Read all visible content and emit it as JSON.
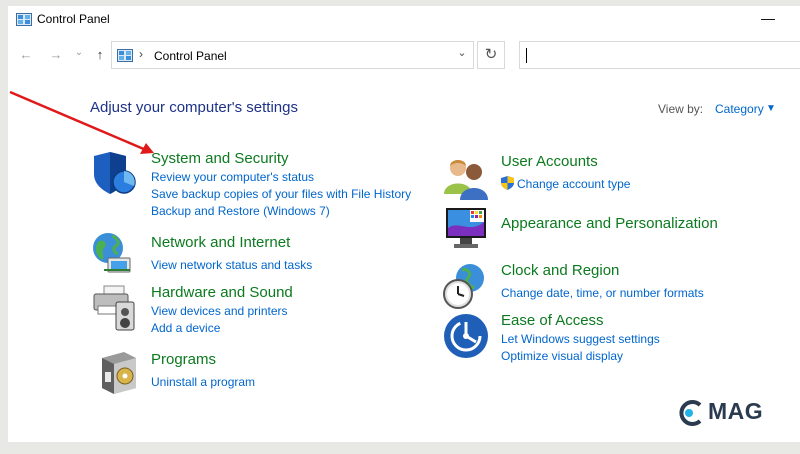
{
  "window": {
    "title": "Control Panel",
    "minimize_glyph": "—"
  },
  "navbar": {
    "back_glyph": "←",
    "forward_glyph": "→",
    "recent_glyph": "⌄",
    "up_glyph": "↑",
    "address_separator": "›",
    "address_text": "Control Panel",
    "dropdown_glyph": "⌄",
    "refresh_glyph": "↻",
    "search_value": ""
  },
  "header": {
    "heading": "Adjust your computer's settings",
    "view_by_label": "View by:",
    "view_by_value": "Category",
    "view_by_arrow": "▼"
  },
  "categories": [
    {
      "title": "System and Security",
      "icon": "shield-icon",
      "links": [
        "Review your computer's status",
        "Save backup copies of your files with File History",
        "Backup and Restore (Windows 7)"
      ]
    },
    {
      "title": "Network and Internet",
      "icon": "globe-network-icon",
      "links": [
        "View network status and tasks"
      ]
    },
    {
      "title": "Hardware and Sound",
      "icon": "printer-speaker-icon",
      "links": [
        "View devices and printers",
        "Add a device"
      ]
    },
    {
      "title": "Programs",
      "icon": "programs-box-icon",
      "links": [
        "Uninstall a program"
      ]
    },
    {
      "title": "User Accounts",
      "icon": "users-icon",
      "links": [
        "Change account type"
      ]
    },
    {
      "title": "Appearance and Personalization",
      "icon": "monitor-palette-icon",
      "links": []
    },
    {
      "title": "Clock and Region",
      "icon": "clock-globe-icon",
      "links": [
        "Change date, time, or number formats"
      ]
    },
    {
      "title": "Ease of Access",
      "icon": "ease-of-access-icon",
      "links": [
        "Let Windows suggest settings",
        "Optimize visual display"
      ]
    }
  ],
  "watermark": {
    "text": "MAG"
  },
  "colors": {
    "heading": "#1e3287",
    "category_title": "#0c7a1f",
    "link": "#0066cc",
    "arrow": "#e01a1a"
  }
}
